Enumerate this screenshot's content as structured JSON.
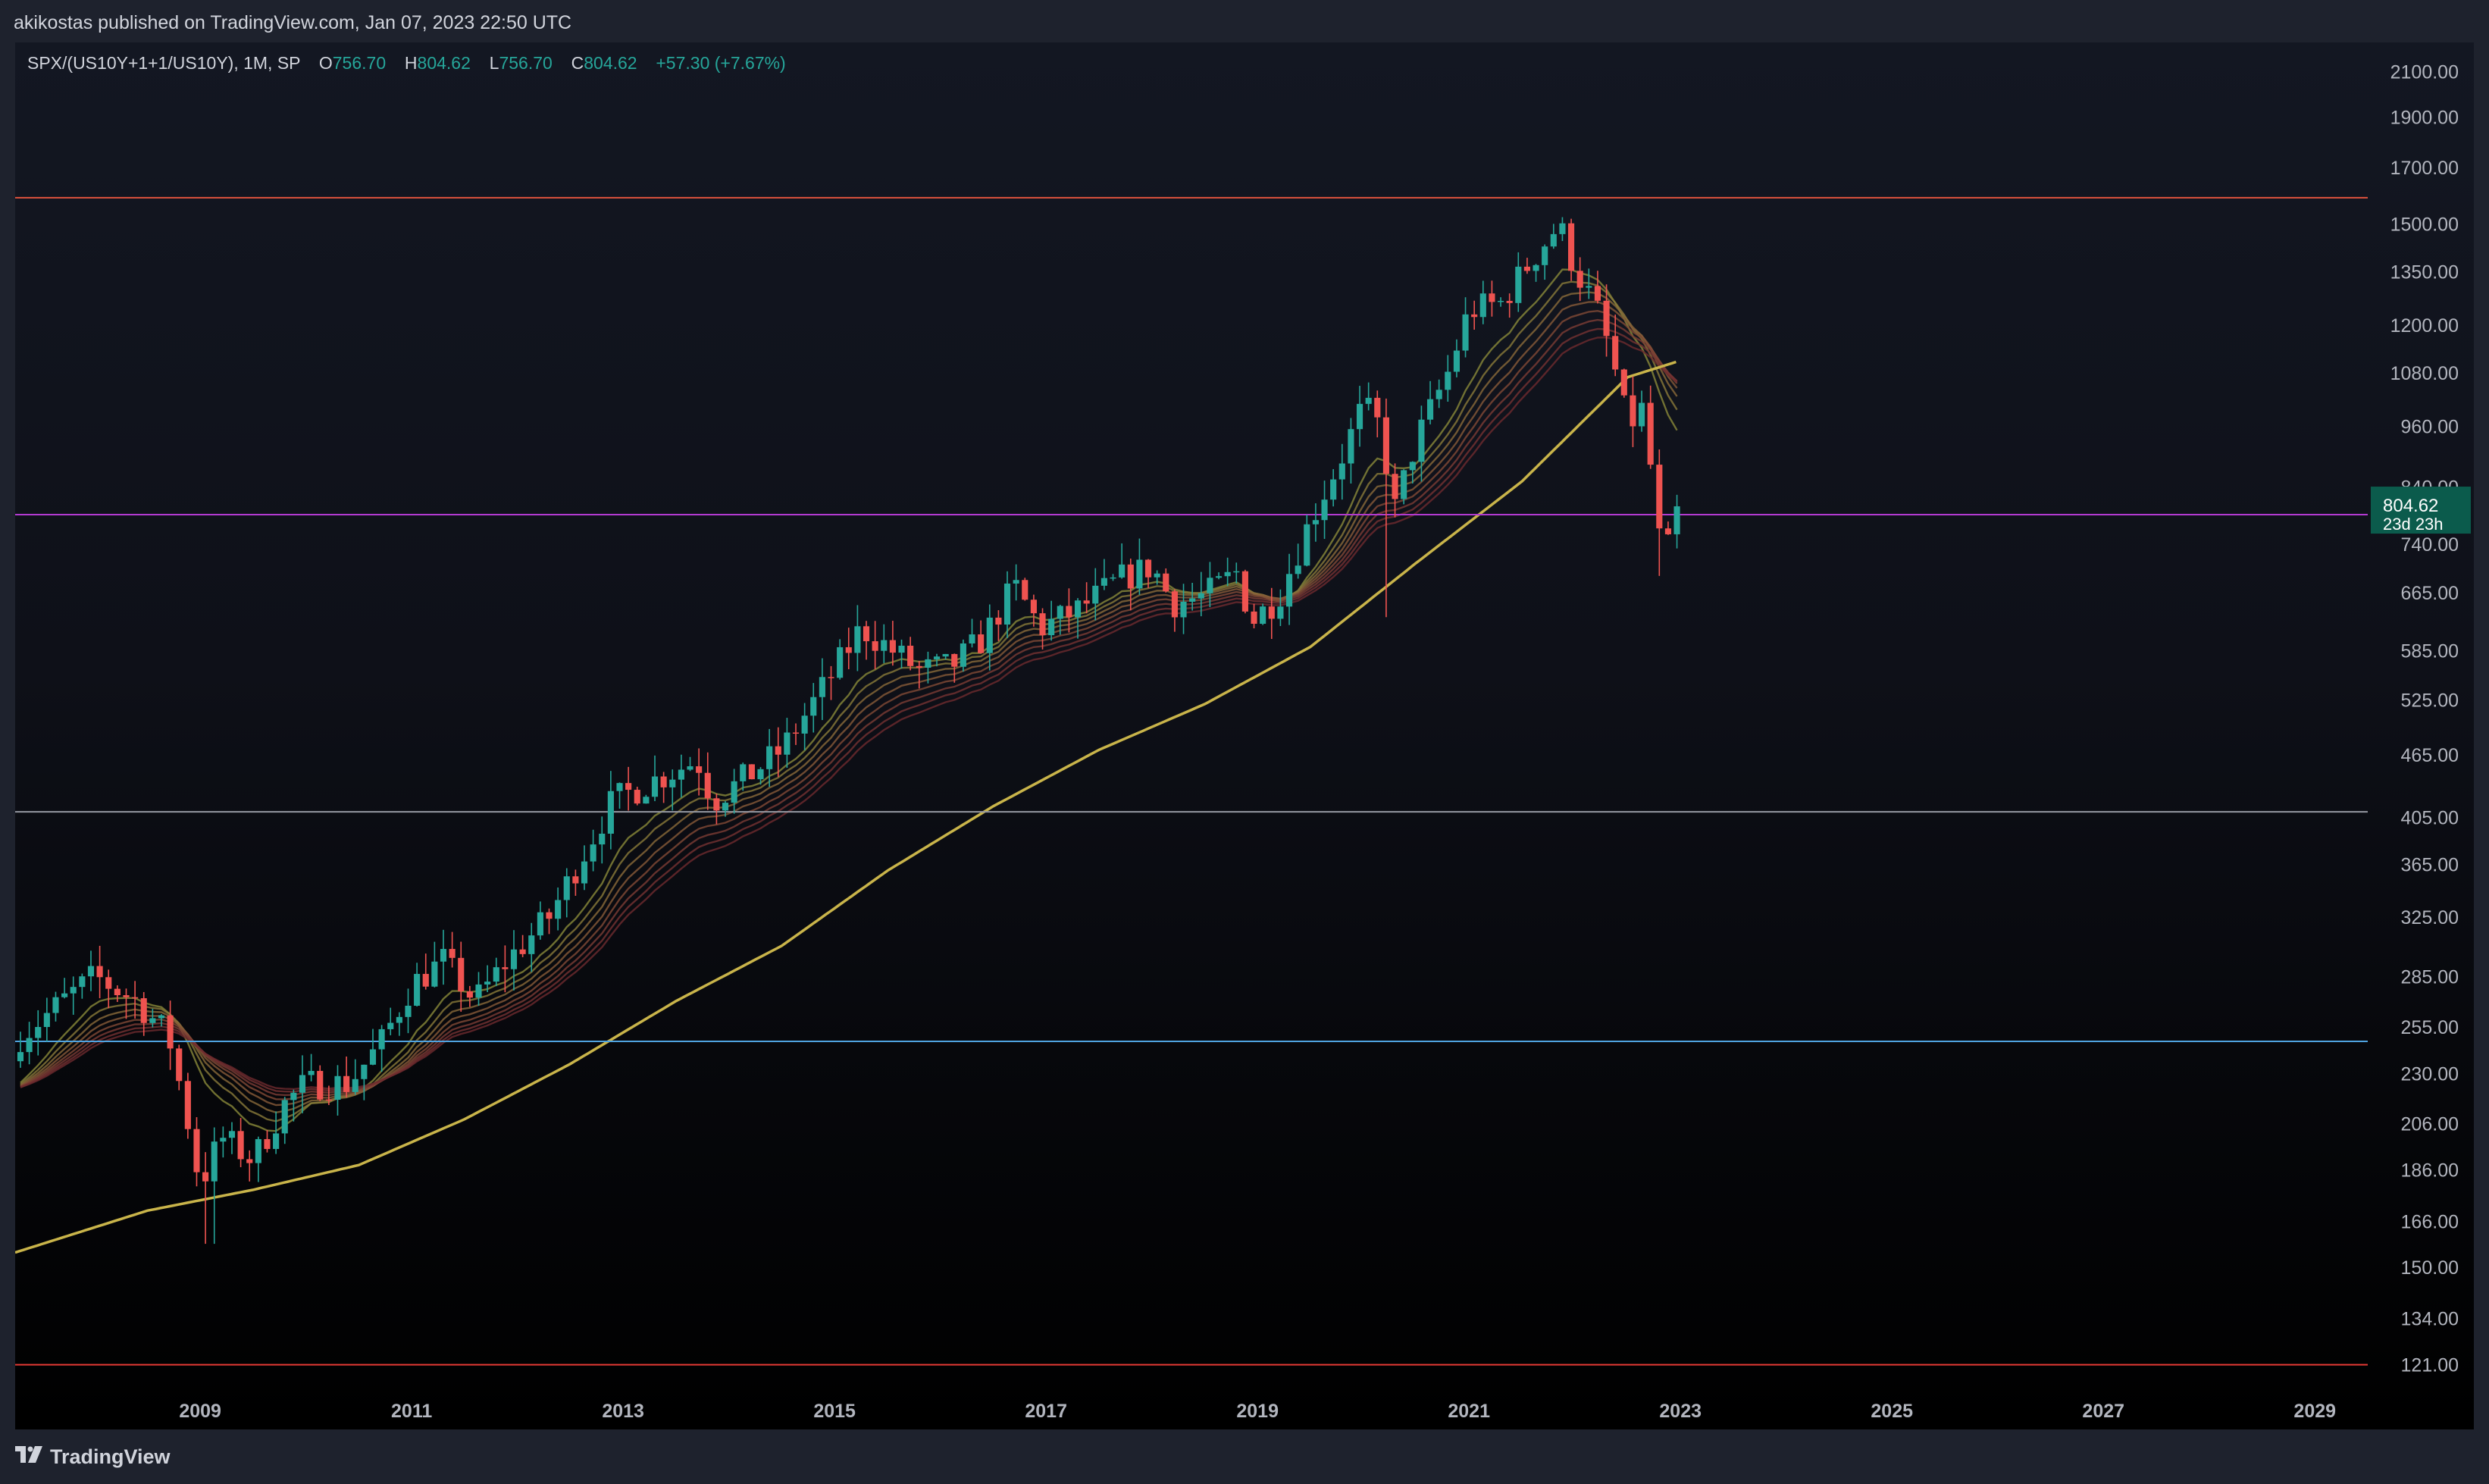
{
  "header": {
    "published_line": "akikostas published on TradingView.com, Jan 07, 2023 22:50 UTC"
  },
  "legend": {
    "symbol": "SPX/(US10Y+1+1/US10Y), 1M, SP",
    "open_label": "O",
    "open": "756.70",
    "high_label": "H",
    "high": "804.62",
    "low_label": "L",
    "low": "756.70",
    "close_label": "C",
    "close": "804.62",
    "change": "+57.30 (+7.67%)"
  },
  "price_badge": {
    "price": "804.62",
    "countdown": "23d 23h"
  },
  "footer": {
    "brand": "TradingView"
  },
  "colors": {
    "up": "#26a69a",
    "down": "#ef5350",
    "ma_long": "#c9b44a",
    "hline_top": "#e0533d",
    "hline_mid": "#b23ad0",
    "hline_grey": "#9598a1",
    "hline_blue": "#4fa3e0",
    "hline_bottom": "#e53935",
    "badge_bg": "#0b5b4c"
  },
  "chart_data": {
    "type": "candlestick",
    "scale": "log",
    "grid": false,
    "x_ticks": [
      "2009",
      "2011",
      "2013",
      "2015",
      "2017",
      "2019",
      "2021",
      "2023",
      "2025",
      "2027",
      "2029"
    ],
    "y_ticks": [
      121,
      134,
      150,
      166,
      186,
      206,
      230,
      255,
      285,
      325,
      365,
      405,
      465,
      525,
      585,
      665,
      740,
      840,
      960,
      1080,
      1200,
      1350,
      1500,
      1700,
      1900,
      2100
    ],
    "y_tick_labels": [
      "121.00",
      "134.00",
      "150.00",
      "166.00",
      "186.00",
      "206.00",
      "230.00",
      "255.00",
      "285.00",
      "325.00",
      "365.00",
      "405.00",
      "465.00",
      "525.00",
      "585.00",
      "665.00",
      "740.00",
      "840.00",
      "960.00",
      "1080.00",
      "1200.00",
      "1350.00",
      "1500.00",
      "1700.00",
      "1900.00",
      "2100.00"
    ],
    "x_range": [
      2007.25,
      2029.5
    ],
    "y_range": [
      115,
      2240
    ],
    "horizontal_lines": [
      {
        "value": 1590,
        "color_key": "hline_top"
      },
      {
        "value": 790,
        "color_key": "hline_mid"
      },
      {
        "value": 410,
        "color_key": "hline_grey"
      },
      {
        "value": 247,
        "color_key": "hline_blue"
      },
      {
        "value": 121,
        "color_key": "hline_bottom"
      }
    ],
    "close_anchors": [
      [
        2007.3,
        250
      ],
      [
        2007.8,
        275
      ],
      [
        2008.0,
        285
      ],
      [
        2008.4,
        270
      ],
      [
        2008.7,
        250
      ],
      [
        2008.85,
        215
      ],
      [
        2009.0,
        180
      ],
      [
        2009.2,
        200
      ],
      [
        2009.5,
        190
      ],
      [
        2009.8,
        215
      ],
      [
        2010.0,
        225
      ],
      [
        2010.4,
        225
      ],
      [
        2010.7,
        245
      ],
      [
        2011.0,
        280
      ],
      [
        2011.3,
        295
      ],
      [
        2011.6,
        270
      ],
      [
        2011.9,
        295
      ],
      [
        2012.3,
        325
      ],
      [
        2012.6,
        370
      ],
      [
        2012.9,
        420
      ],
      [
        2013.3,
        440
      ],
      [
        2013.7,
        460
      ],
      [
        2013.85,
        420
      ],
      [
        2014.2,
        445
      ],
      [
        2014.5,
        470
      ],
      [
        2015.0,
        560
      ],
      [
        2015.25,
        615
      ],
      [
        2015.5,
        590
      ],
      [
        2015.8,
        560
      ],
      [
        2016.1,
        565
      ],
      [
        2016.4,
        600
      ],
      [
        2016.7,
        675
      ],
      [
        2016.95,
        615
      ],
      [
        2017.3,
        640
      ],
      [
        2017.7,
        685
      ],
      [
        2018.0,
        705
      ],
      [
        2018.2,
        650
      ],
      [
        2018.5,
        660
      ],
      [
        2018.8,
        695
      ],
      [
        2018.95,
        625
      ],
      [
        2019.2,
        660
      ],
      [
        2019.5,
        780
      ],
      [
        2019.8,
        900
      ],
      [
        2020.0,
        1005
      ],
      [
        2020.15,
        960
      ],
      [
        2020.3,
        800
      ],
      [
        2020.5,
        930
      ],
      [
        2020.8,
        1080
      ],
      [
        2021.0,
        1240
      ],
      [
        2021.3,
        1260
      ],
      [
        2021.6,
        1390
      ],
      [
        2021.85,
        1500
      ],
      [
        2022.0,
        1360
      ],
      [
        2022.2,
        1250
      ],
      [
        2022.35,
        1120
      ],
      [
        2022.5,
        960
      ],
      [
        2022.65,
        1000
      ],
      [
        2022.8,
        750
      ],
      [
        2022.9,
        730
      ],
      [
        2023.0,
        805
      ]
    ],
    "ma_long_anchors": [
      [
        2007.25,
        155
      ],
      [
        2008.5,
        170
      ],
      [
        2009.5,
        178
      ],
      [
        2010.5,
        188
      ],
      [
        2011.5,
        208
      ],
      [
        2012.5,
        235
      ],
      [
        2013.5,
        270
      ],
      [
        2014.5,
        305
      ],
      [
        2015.5,
        360
      ],
      [
        2016.5,
        415
      ],
      [
        2017.5,
        470
      ],
      [
        2018.5,
        520
      ],
      [
        2019.5,
        590
      ],
      [
        2020.5,
        710
      ],
      [
        2021.5,
        850
      ],
      [
        2022.5,
        1070
      ],
      [
        2023.0,
        1110
      ]
    ],
    "ribbon_count": 8
  }
}
